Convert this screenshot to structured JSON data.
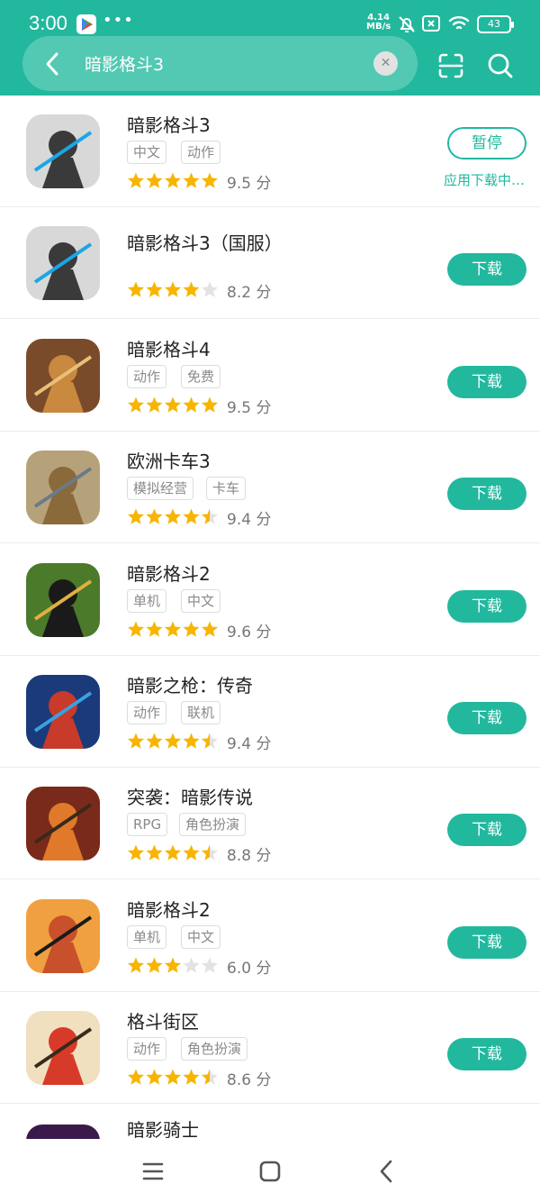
{
  "status_bar": {
    "time": "3:00",
    "speed_value": "4.14",
    "speed_unit": "MB/s",
    "battery": "43"
  },
  "search": {
    "query": "暗影格斗3",
    "clear_icon": "close-icon",
    "back_icon": "chevron-left-icon",
    "scan_icon": "scan-icon",
    "search_icon": "search-icon"
  },
  "colors": {
    "accent": "#22b89e",
    "star": "#f7b500",
    "star_empty": "#e3e3e3"
  },
  "apps": [
    {
      "name": "暗影格斗3",
      "tags": [
        "中文",
        "动作"
      ],
      "rating": 5,
      "score": "9.5 分",
      "action": "暂停",
      "status": "应用下载中…",
      "icon": "shadow-fight-3-icon"
    },
    {
      "name": "暗影格斗3（国服）",
      "tags": [],
      "rating": 4,
      "score": "8.2 分",
      "action": "下载",
      "icon": "shadow-fight-3-cn-icon"
    },
    {
      "name": "暗影格斗4",
      "tags": [
        "动作",
        "免费"
      ],
      "rating": 5,
      "score": "9.5 分",
      "action": "下载",
      "icon": "shadow-fight-4-icon"
    },
    {
      "name": "欧洲卡车3",
      "tags": [
        "模拟经营",
        "卡车"
      ],
      "rating": 4.5,
      "score": "9.4 分",
      "action": "下载",
      "icon": "euro-truck-icon"
    },
    {
      "name": "暗影格斗2",
      "tags": [
        "单机",
        "中文"
      ],
      "rating": 5,
      "score": "9.6 分",
      "action": "下载",
      "icon": "shadow-fight-2-icon"
    },
    {
      "name": "暗影之枪：传奇",
      "tags": [
        "动作",
        "联机"
      ],
      "rating": 4.5,
      "score": "9.4 分",
      "action": "下载",
      "icon": "shadowgun-legends-icon"
    },
    {
      "name": "突袭：暗影传说",
      "tags": [
        "RPG",
        "角色扮演"
      ],
      "rating": 4.5,
      "score": "8.8 分",
      "action": "下载",
      "icon": "raid-shadow-legends-icon"
    },
    {
      "name": "暗影格斗2",
      "tags": [
        "单机",
        "中文"
      ],
      "rating": 3,
      "score": "6.0 分",
      "action": "下载",
      "icon": "shadow-fight-2-2024-icon"
    },
    {
      "name": "格斗街区",
      "tags": [
        "动作",
        "角色扮演"
      ],
      "rating": 4.5,
      "score": "8.6 分",
      "action": "下载",
      "icon": "street-fighter-icon"
    },
    {
      "name": "暗影骑士",
      "tags": [],
      "rating": 0,
      "score": "",
      "action": "",
      "icon": "shadow-knight-icon"
    }
  ],
  "navbar": {
    "menu_icon": "menu-icon",
    "home_icon": "home-icon",
    "back_icon": "back-icon"
  }
}
